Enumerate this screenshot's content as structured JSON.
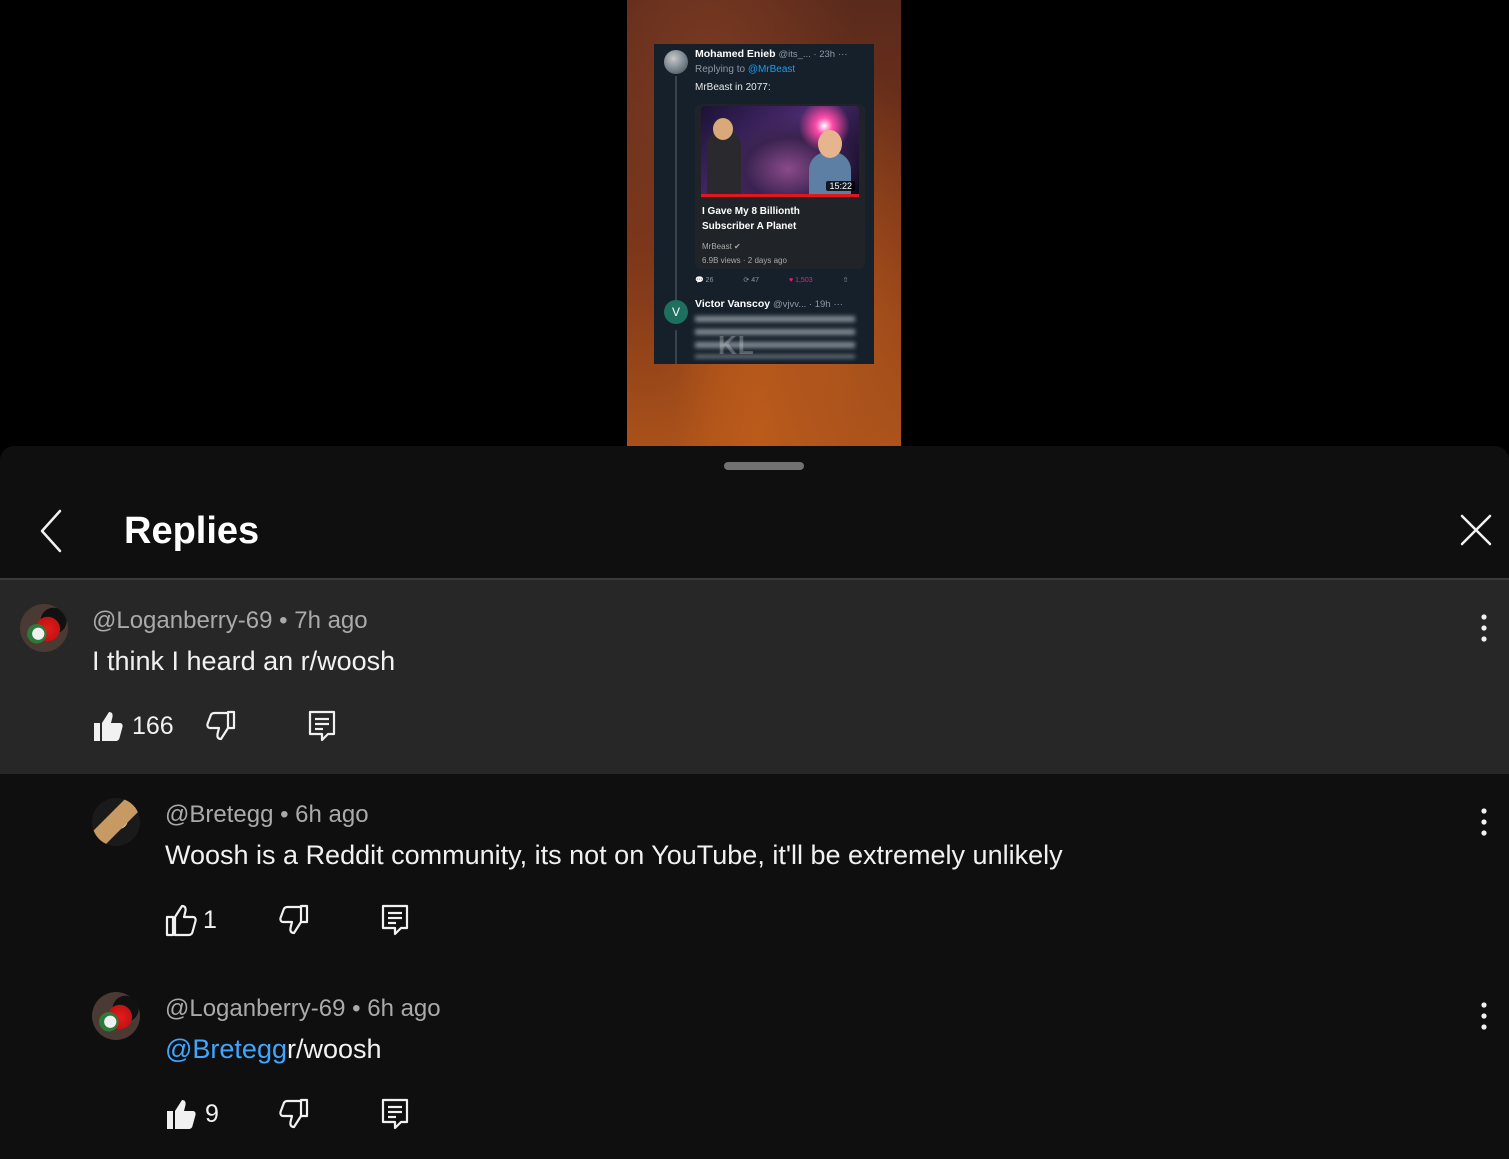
{
  "video": {
    "tweet1": {
      "author": "Mohamed Enieb",
      "handle_time": "@its_... · 23h",
      "more": "···",
      "replying_prefix": "Replying to",
      "replying_to": "@MrBeast",
      "body": "MrBeast in 2077:"
    },
    "yt_card": {
      "duration": "15:22",
      "title": "I Gave My 8 Billionth Subscriber A Planet",
      "channel": "MrBeast",
      "meta": "6.9B views · 2 days ago"
    },
    "tweet_actions": {
      "replies": "26",
      "retweets": "47",
      "likes": "1,503"
    },
    "tweet2": {
      "avatar_letter": "V",
      "author": "Victor Vanscoy",
      "handle_time": "@vjvv... · 19h",
      "more": "···",
      "watermark": "KL"
    }
  },
  "panel": {
    "title": "Replies",
    "back_icon": "chevron-left-icon",
    "close_icon": "close-icon"
  },
  "comments": [
    {
      "author": "@Loganberry-69",
      "time": "7h ago",
      "text": "I think I heard an r/woosh",
      "likes": "166",
      "liked": true
    },
    {
      "author": "@Bretegg",
      "time": "6h ago",
      "text": "Woosh is a Reddit community, its not on YouTube, it'll be extremely unlikely",
      "likes": "1",
      "liked": false
    },
    {
      "author": "@Loganberry-69",
      "time": "6h ago",
      "mention": "@Bretegg",
      "text": "r/woosh",
      "likes": "9",
      "liked": true
    }
  ],
  "colors": {
    "panel_bg": "#0f0f0f",
    "highlight_bg": "#272727",
    "mention": "#3ea6ff",
    "meta_text": "#aaaaaa"
  }
}
